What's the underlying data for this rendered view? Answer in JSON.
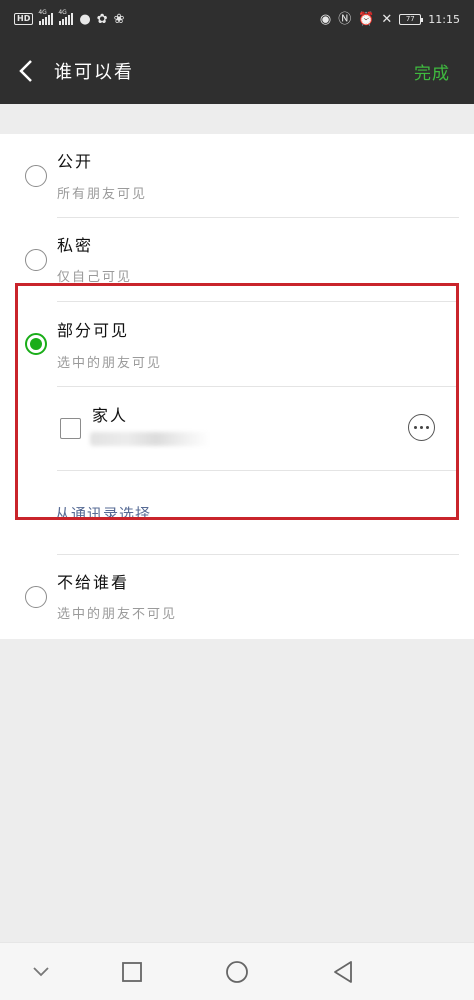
{
  "status_bar": {
    "hd": "HD",
    "net1": "4G",
    "net2": "4G",
    "battery": "77",
    "time": "11:15"
  },
  "header": {
    "title": "谁可以看",
    "done_label": "完成",
    "done_color": "#3fba3f"
  },
  "options": [
    {
      "title": "公开",
      "subtitle": "所有朋友可见",
      "selected": false
    },
    {
      "title": "私密",
      "subtitle": "仅自己可见",
      "selected": false
    },
    {
      "title": "部分可见",
      "subtitle": "选中的朋友可见",
      "selected": true
    },
    {
      "title": "不给谁看",
      "subtitle": "选中的朋友不可见",
      "selected": false
    }
  ],
  "partial_visible": {
    "group_name": "家人",
    "contacts_link": "从通讯录选择"
  },
  "icons": {
    "back": "chevron-left-icon",
    "more": "more-dots-icon",
    "nav": [
      "nav-down-icon",
      "nav-square-icon",
      "nav-circle-icon",
      "nav-back-triangle-icon"
    ]
  },
  "colors": {
    "accent": "#1aad19",
    "highlight": "#c9242b",
    "link": "#576b95"
  }
}
